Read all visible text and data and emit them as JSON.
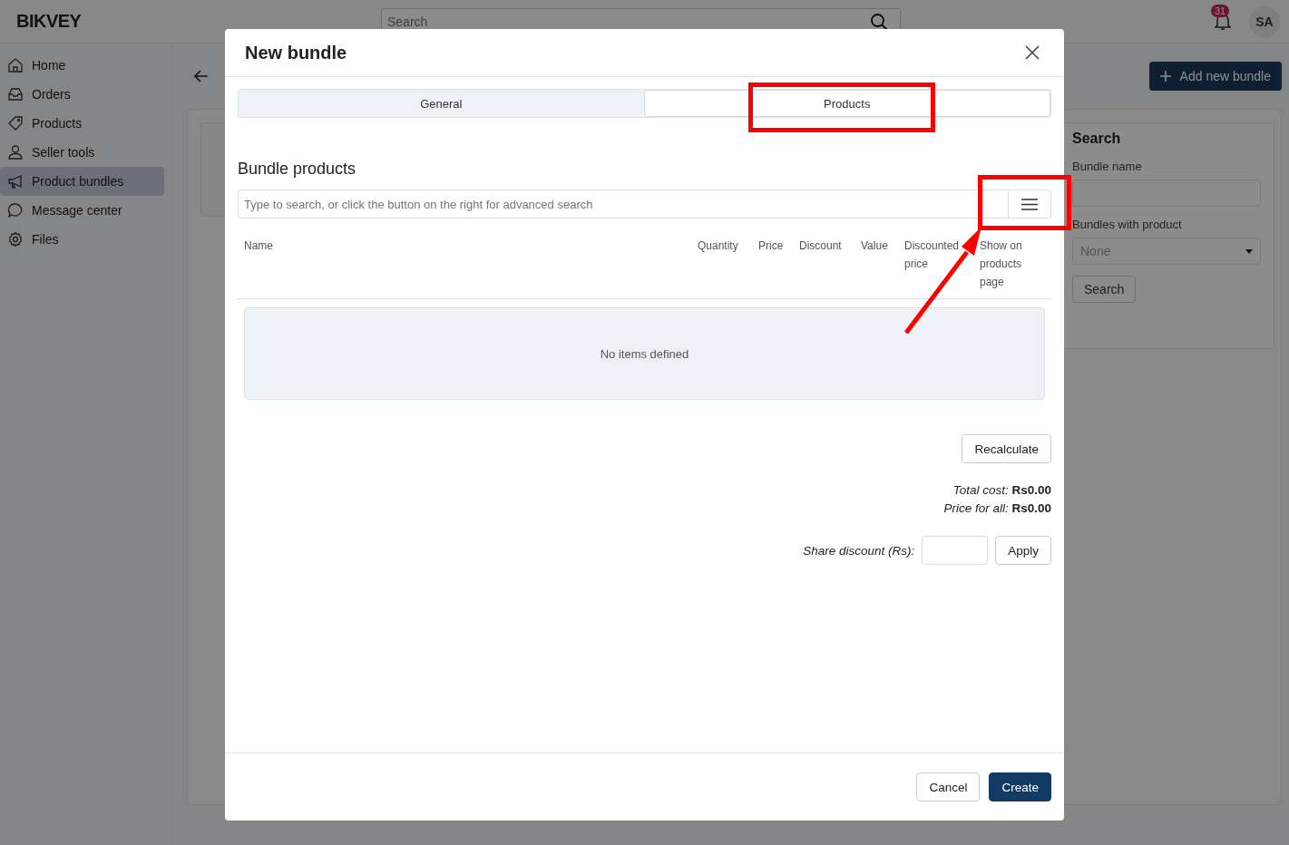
{
  "header": {
    "logo": "BIKVEY",
    "search_placeholder": "Search",
    "notifications": "31",
    "avatar": "SA"
  },
  "sidebar": {
    "items": [
      {
        "label": "Home",
        "kind": "home",
        "selected": false
      },
      {
        "label": "Orders",
        "kind": "inbox",
        "selected": false
      },
      {
        "label": "Products",
        "kind": "tag",
        "selected": false
      },
      {
        "label": "Seller tools",
        "kind": "user",
        "selected": false
      },
      {
        "label": "Product bundles",
        "kind": "megaphone",
        "selected": true
      },
      {
        "label": "Message center",
        "kind": "chat",
        "selected": false
      },
      {
        "label": "Files",
        "kind": "gear",
        "selected": false
      }
    ]
  },
  "page": {
    "add_button": "Add new bundle",
    "search_panel": {
      "title": "Search",
      "fields": [
        {
          "label": "Bundle name",
          "kind": "text"
        },
        {
          "label": "Bundles with product",
          "kind": "select",
          "value": "None"
        }
      ],
      "button": "Search"
    }
  },
  "dialog": {
    "title": "New bundle",
    "tabs": [
      {
        "label": "General",
        "selected": false
      },
      {
        "label": "Products",
        "selected": true
      }
    ],
    "section_title": "Bundle products",
    "search": {
      "placeholder": "Type to search, or click the button on the right for advanced search"
    },
    "columns": [
      "Name",
      "Quantity",
      "Price",
      "Discount",
      "Value",
      "Discounted price",
      "Show on products page"
    ],
    "empty_message": "No items defined",
    "recalculate_button": "Recalculate",
    "totals": [
      "*Total cost:* **Rs0.00**",
      "*Price for all:* **Rs0.00**"
    ],
    "share_discount": {
      "label": "Share discount (Rs):"
    },
    "apply_button": "Apply",
    "buttons": [
      {
        "label": "Cancel",
        "kind": "secondary"
      },
      {
        "label": "Create",
        "kind": "primary"
      }
    ]
  }
}
